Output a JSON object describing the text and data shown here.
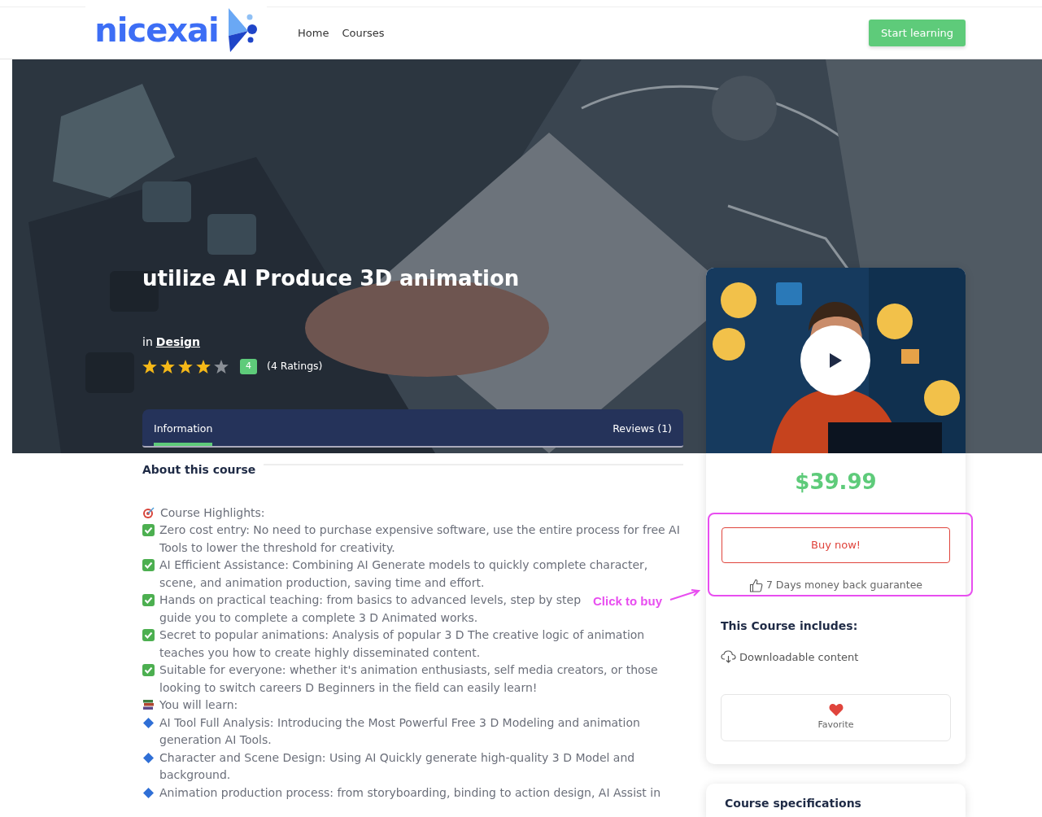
{
  "header": {
    "logo": "nicexai",
    "nav": [
      {
        "label": "Home"
      },
      {
        "label": "Courses"
      }
    ],
    "cta": "Start learning"
  },
  "course": {
    "title": "utilize AI Produce 3D animation",
    "category_prefix": "in",
    "category": "Design",
    "rating": {
      "stars": 4,
      "score": "4",
      "count": "(4 Ratings)"
    }
  },
  "tabs": [
    {
      "label": "Information",
      "selected": true
    },
    {
      "label": "Reviews (1)",
      "selected": false
    }
  ],
  "about": {
    "heading": "About this course",
    "lines": [
      {
        "kind": "target",
        "text": "Course Highlights:"
      },
      {
        "kind": "check",
        "text": "Zero cost entry: No need to purchase expensive software, use the entire process for free AI Tools to lower the threshold for creativity."
      },
      {
        "kind": "check",
        "text": "AI Efficient Assistance: Combining AI Generate models to quickly complete character, scene, and animation production, saving time and effort."
      },
      {
        "kind": "check",
        "text": "Hands on practical teaching: from basics to advanced levels, step by step guide you to complete a complete 3 D Animated works."
      },
      {
        "kind": "check",
        "text": "Secret to popular animations: Analysis of popular 3 D The creative logic of animation teaches you how to create highly disseminated content."
      },
      {
        "kind": "check",
        "text": "Suitable for everyone: whether it's animation enthusiasts, self media creators, or those looking to switch careers D Beginners in the field can easily learn!"
      },
      {
        "kind": "books",
        "text": "You will learn:"
      },
      {
        "kind": "diamond",
        "text": "AI Tool Full Analysis: Introducing the Most Powerful Free 3 D Modeling and animation generation AI Tools."
      },
      {
        "kind": "diamond",
        "text": "Character and Scene Design: Using AI Quickly generate high-quality 3 D Model and background."
      },
      {
        "kind": "diamond",
        "text": "Animation production process: from storyboarding, binding to action design, AI Assist in"
      }
    ]
  },
  "sidebar": {
    "price": "$39.99",
    "buy_button": "Buy now!",
    "guarantee": "7 Days money back guarantee",
    "includes_heading": "This Course includes:",
    "includes": [
      {
        "text": "Downloadable content"
      }
    ],
    "favorite": "Favorite"
  },
  "annotation": {
    "text": "Click to buy"
  },
  "specs": {
    "heading": "Course specifications"
  }
}
